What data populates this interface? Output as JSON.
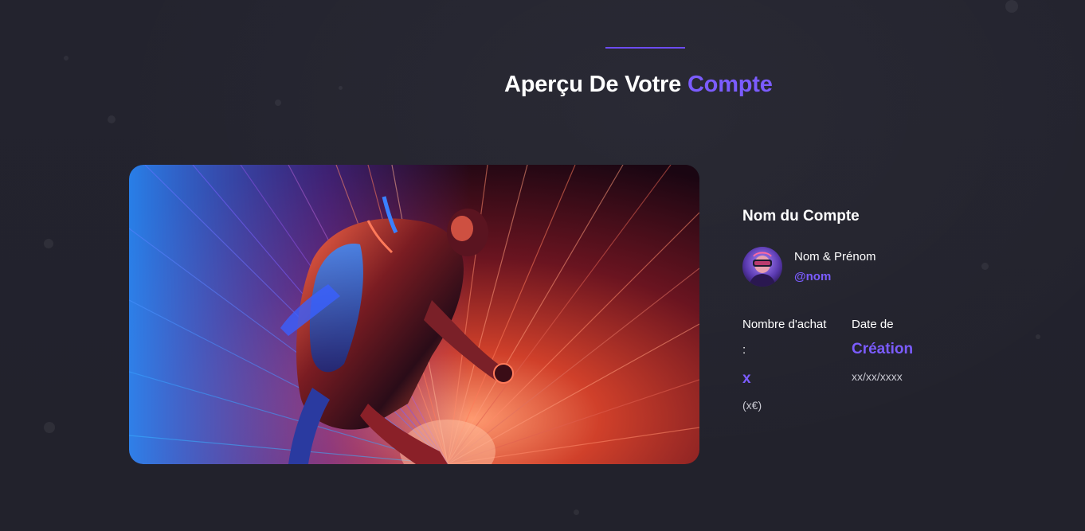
{
  "header": {
    "title_main": "Aperçu De Votre",
    "title_accent": "Compte"
  },
  "hero_image": {
    "icon": "cyber-runner-illustration"
  },
  "account": {
    "name_heading": "Nom du Compte",
    "avatar_icon": "vr-user-avatar",
    "full_name": "Nom & Prénom",
    "handle": "@nom"
  },
  "stats": {
    "purchases_label": "Nombre d'achat",
    "purchases_colon": ":",
    "purchases_value": "x",
    "purchases_amount": "(x€)",
    "creation_label": "Date de",
    "creation_value": "Création",
    "creation_date": "xx/xx/xxxx"
  },
  "colors": {
    "accent": "#7b5cff",
    "background": "#22222d",
    "divider": "#6c4cf1"
  }
}
